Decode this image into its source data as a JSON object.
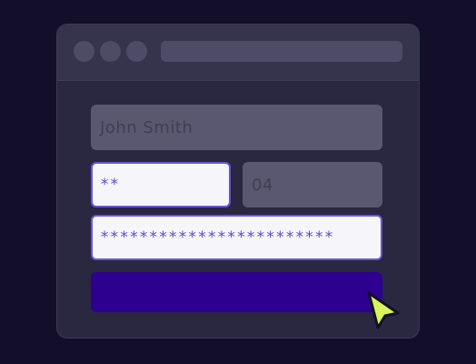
{
  "form": {
    "name_value": "John Smith",
    "card_value": "**",
    "expiry_value": "04",
    "password_value": "************************",
    "submit_label": ""
  },
  "colors": {
    "background": "#130e2a",
    "window": "#2a2740",
    "accent": "#6a55d8",
    "submit": "#2d0090",
    "cursor": "#d8f55a"
  },
  "icons": {
    "cursor": "mouse-pointer-icon"
  }
}
